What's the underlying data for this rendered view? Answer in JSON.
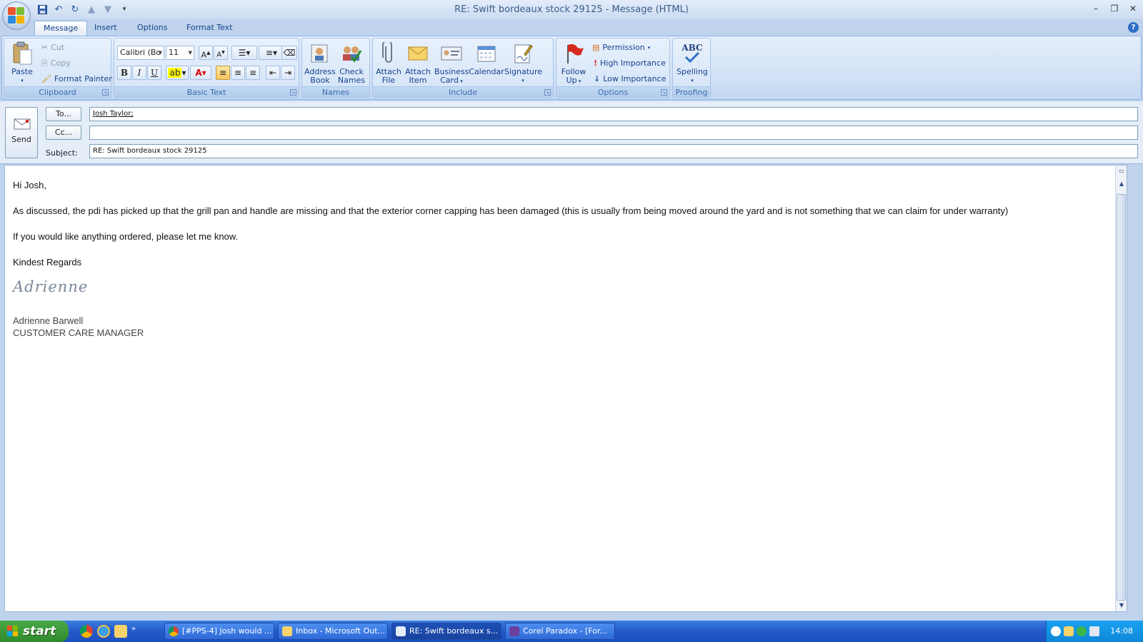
{
  "window": {
    "title": "RE: Swift bordeaux stock 29125 - Message (HTML)"
  },
  "tabs": [
    {
      "label": "Message"
    },
    {
      "label": "Insert"
    },
    {
      "label": "Options"
    },
    {
      "label": "Format Text"
    }
  ],
  "ribbon": {
    "clipboard": {
      "label": "Clipboard",
      "paste": "Paste",
      "cut": "Cut",
      "copy": "Copy",
      "format_painter": "Format Painter"
    },
    "basic_text": {
      "label": "Basic Text",
      "font": "Calibri (Bo",
      "size": "11"
    },
    "names": {
      "label": "Names",
      "address_book": [
        "Address",
        "Book"
      ],
      "check_names": [
        "Check",
        "Names"
      ]
    },
    "include": {
      "label": "Include",
      "attach_file": [
        "Attach",
        "File"
      ],
      "attach_item": [
        "Attach",
        "Item"
      ],
      "business_card": [
        "Business",
        "Card"
      ],
      "calendar": "Calendar",
      "signature": "Signature"
    },
    "options": {
      "label": "Options",
      "follow_up": [
        "Follow",
        "Up"
      ],
      "permission": "Permission",
      "high": "High Importance",
      "low": "Low Importance"
    },
    "proofing": {
      "label": "Proofing",
      "spelling": "Spelling",
      "abc": "ABC"
    }
  },
  "header": {
    "send": "Send",
    "to_button": "To...",
    "cc_button": "Cc...",
    "subject_label": "Subject:",
    "to_value": "Josh Taylor;",
    "cc_value": "",
    "subject_value": "RE: Swift bordeaux stock 29125"
  },
  "body": {
    "greeting": "Hi Josh,",
    "para1": "As discussed, the pdi has picked up that the grill pan and handle are missing and that the exterior corner capping has been damaged (this is usually from being moved around the yard and is not something that we can claim for under warranty)",
    "para2": "If  you would like anything ordered, please let me know.",
    "closing": "Kindest Regards",
    "signature_script": "Adrienne",
    "sig_name": "Adrienne Barwell",
    "sig_title": "CUSTOMER CARE MANAGER"
  },
  "taskbar": {
    "start": "start",
    "tasks": [
      {
        "label": "[#PPS-4] Josh would ..."
      },
      {
        "label": "Inbox - Microsoft Out..."
      },
      {
        "label": "RE: Swift bordeaux s..."
      },
      {
        "label": "Corel Paradox - [For..."
      }
    ],
    "clock": "14:08"
  },
  "colors": {
    "ribbon_text": "#15428b",
    "taskbar": "#2459c9",
    "start": "#2f8a2c"
  }
}
